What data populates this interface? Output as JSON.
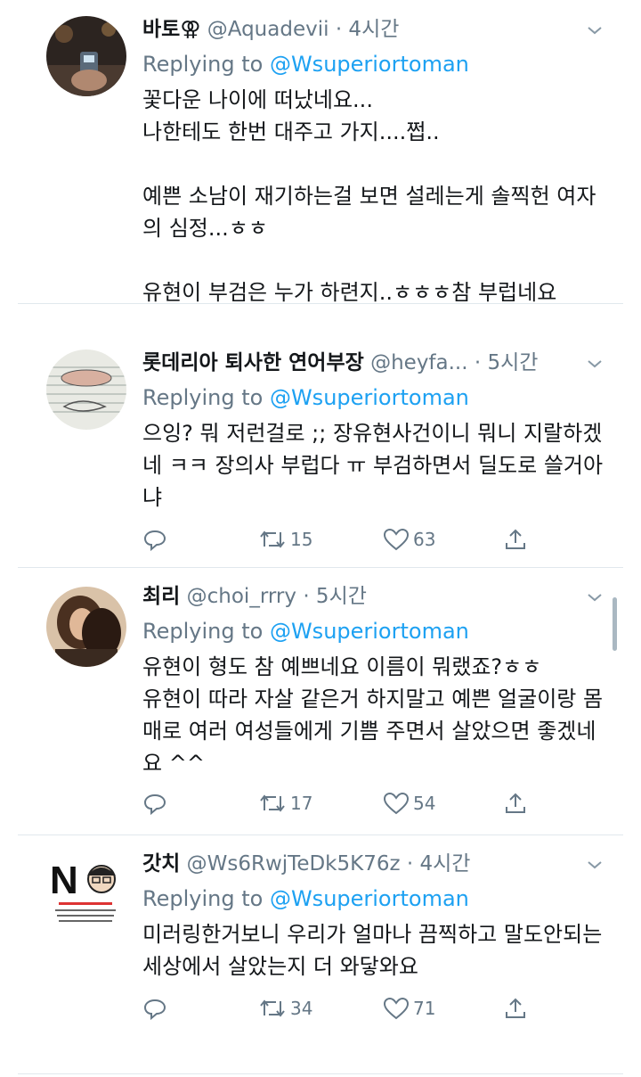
{
  "tweets": [
    {
      "name": "바토",
      "emoji": "⚢",
      "handle": "@Aquadevii",
      "time": "· 4시간",
      "reply_prefix": "Replying to",
      "reply_to": "@Wsuperiortoman",
      "body": "꽃다운 나이에 떠났네요...\n나한테도 한번 대주고 가지....쩝..\n\n예쁜 소남이 재기하는걸 보면 설레는게 솔찍헌 여자의 심정...ㅎㅎ\n\n유현이 부검은 누가 하련지..ㅎㅎㅎ참 부럽네요"
    },
    {
      "name": "롯데리아 퇴사한 연어부장",
      "handle": "@heyfa...",
      "time": "· 5시간",
      "reply_prefix": "Replying to",
      "reply_to": "@Wsuperiortoman",
      "body": "으잉? 뭐 저런걸로 ;; 장유현사건이니 뭐니 지랄하겠네 ㅋㅋ 장의사 부럽다 ㅠ 부검하면서 딜도로 쓸거아냐",
      "retweets": "15",
      "likes": "63"
    },
    {
      "name": "최리",
      "handle": "@choi_rrry",
      "time": "· 5시간",
      "reply_prefix": "Replying to",
      "reply_to": "@Wsuperiortoman",
      "body": "유현이 형도 참 예쁘네요 이름이 뭐랬죠?ㅎㅎ\n유현이 따라 자살 같은거 하지말고 예쁜 얼굴이랑 몸매로 여러 여성들에게 기쁨 주면서 살았으면 좋겠네요 ^^",
      "retweets": "17",
      "likes": "54"
    },
    {
      "name": "갓치",
      "handle": "@Ws6RwjTeDk5K76z",
      "time": "· 4시간",
      "reply_prefix": "Replying to",
      "reply_to": "@Wsuperiortoman",
      "body": "미러링한거보니 우리가 얼마나 끔찍하고 말도안되는 세상에서 살았는지 더 와닿와요",
      "retweets": "34",
      "likes": "71",
      "avatar_letter": "N"
    }
  ],
  "colors": {
    "link": "#1da1f2",
    "secondary": "#657786",
    "divider": "#e1e8ed"
  },
  "icons": [
    "reply-icon",
    "retweet-icon",
    "like-icon",
    "share-icon",
    "chevron-down-icon"
  ]
}
